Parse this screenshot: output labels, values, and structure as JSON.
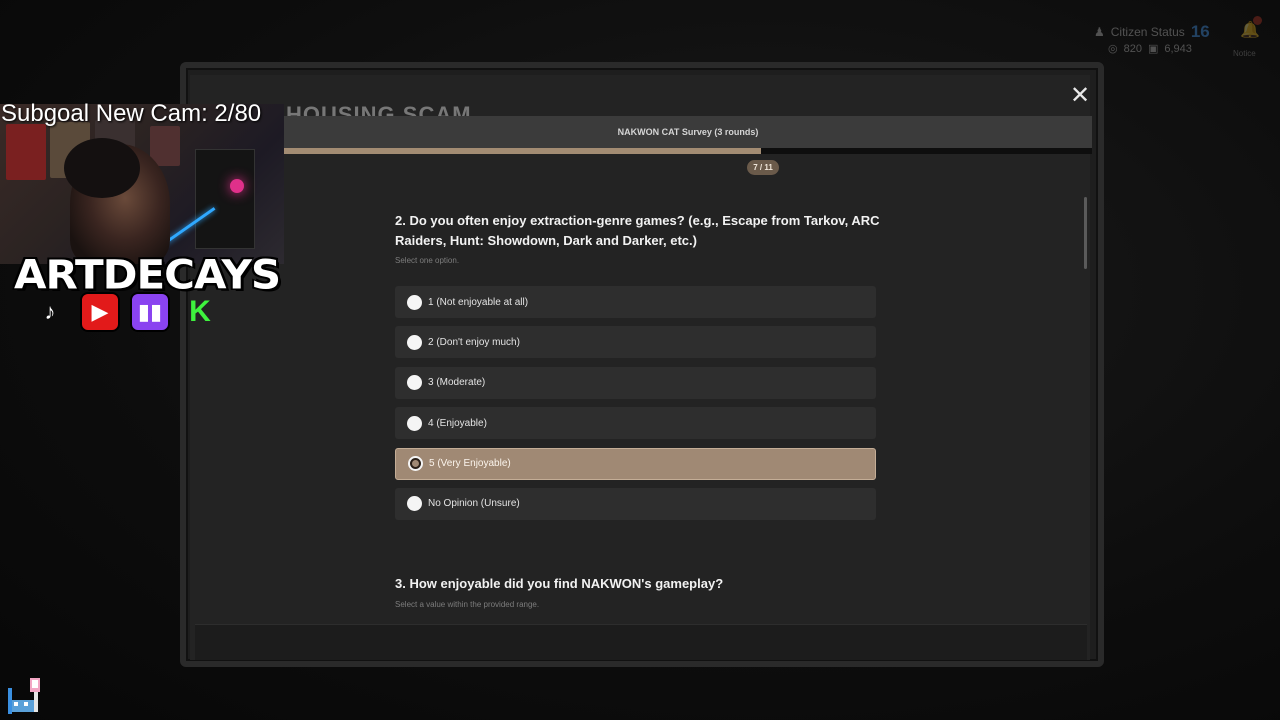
{
  "hud": {
    "citizen_status_label": "Citizen Status",
    "level": "16",
    "currency_a": "820",
    "currency_b": "6,943",
    "notifications_label": "Notice"
  },
  "modal": {
    "background_title": "HOUSING SCAM",
    "survey_title": "NAKWON CAT Survey (3 rounds)",
    "progress_label": "7 / 11",
    "progress_fraction": 0.59
  },
  "question": {
    "title": "2. Do you often enjoy extraction-genre games? (e.g., Escape from Tarkov, ARC Raiders, Hunt: Showdown, Dark and Darker, etc.)",
    "hint": "Select one option.",
    "options": [
      {
        "label": "1 (Not enjoyable at all)",
        "selected": false
      },
      {
        "label": "2 (Don't enjoy much)",
        "selected": false
      },
      {
        "label": "3 (Moderate)",
        "selected": false
      },
      {
        "label": "4 (Enjoyable)",
        "selected": false
      },
      {
        "label": "5 (Very Enjoyable)",
        "selected": true
      },
      {
        "label": "No Opinion (Unsure)",
        "selected": false
      }
    ]
  },
  "next_question": {
    "title": "3. How enjoyable did you find NAKWON's gameplay?",
    "hint": "Select a value within the provided range."
  },
  "overlay": {
    "subgoal_text": "Subgoal New Cam: 2/80",
    "brand": "ARTDECAYS",
    "socials": [
      "tiktok-icon",
      "youtube-icon",
      "twitch-icon",
      "kick-icon"
    ]
  },
  "colors": {
    "accent": "#a08974",
    "progress_fill": "#a38c73",
    "modal_bg": "#232323",
    "option_bg": "#2e2e2e"
  }
}
